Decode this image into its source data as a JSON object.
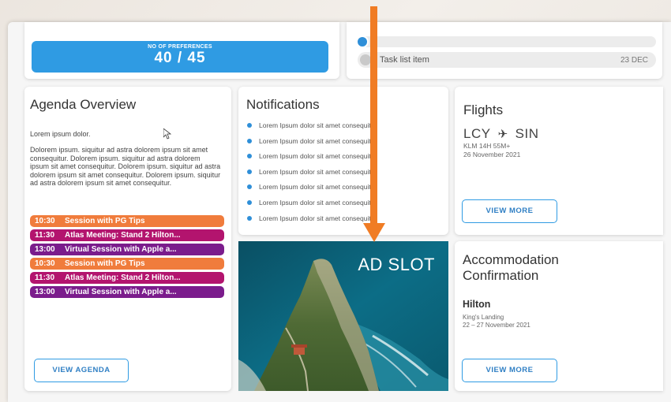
{
  "preferences": {
    "label": "NO OF PREFERENCES",
    "value": "40 / 45"
  },
  "tasks": [
    {
      "text": "Task list item",
      "date": "23 DEC"
    }
  ],
  "agenda": {
    "title": "Agenda Overview",
    "intro": "Lorem ipsum dolor.",
    "body": "Dolorem ipsum. siquitur ad astra dolorem ipsum sit amet consequitur. Dolorem ipsum. siquitur ad astra dolorem ipsum sit amet consequitur. Dolorem ipsum. siquitur ad astra dolorem ipsum sit amet consequitur. Dolorem ipsum. siquitur ad astra dolorem ipsum sit amet consequitur.",
    "sessions": [
      {
        "time": "10:30",
        "title": "Session with PG Tips",
        "color": "#f07c3c"
      },
      {
        "time": "11:30",
        "title": "Atlas Meeting: Stand 2 Hilton...",
        "color": "#b3146e"
      },
      {
        "time": "13:00",
        "title": "Virtual Session with Apple a...",
        "color": "#7b1c8c"
      },
      {
        "time": "10:30",
        "title": "Session with PG Tips",
        "color": "#f07c3c"
      },
      {
        "time": "11:30",
        "title": "Atlas Meeting: Stand 2 Hilton...",
        "color": "#b3146e"
      },
      {
        "time": "13:00",
        "title": "Virtual Session with Apple a...",
        "color": "#7b1c8c"
      }
    ],
    "button": "VIEW AGENDA"
  },
  "notifications": {
    "title": "Notifications",
    "items": [
      "Lorem Ipsum dolor sit amet consequitur",
      "Lorem Ipsum dolor sit amet consequitur",
      "Lorem Ipsum dolor sit amet consequitur",
      "Lorem Ipsum dolor sit amet consequitur",
      "Lorem Ipsum dolor sit amet consequitur",
      "Lorem Ipsum dolor sit amet consequitur",
      "Lorem Ipsum dolor sit amet consequitur"
    ]
  },
  "flights": {
    "title": "Flights",
    "from": "LCY",
    "to": "SIN",
    "detail": "KLM 14H 55M+",
    "date": "26 November 2021",
    "button": "VIEW MORE"
  },
  "ad": {
    "label": "AD SLOT"
  },
  "accommodation": {
    "title_line1": "Accommodation",
    "title_line2": "Confirmation",
    "hotel": "Hilton",
    "location": "King's Landing",
    "dates": "22 – 27 November 2021",
    "button": "VIEW MORE"
  },
  "colors": {
    "accent": "#2f9be3",
    "arrow": "#f07c24"
  },
  "icons": {
    "plane": "plane-icon",
    "check": "check-circle-icon",
    "notif_bullet": "bullet-icon"
  }
}
